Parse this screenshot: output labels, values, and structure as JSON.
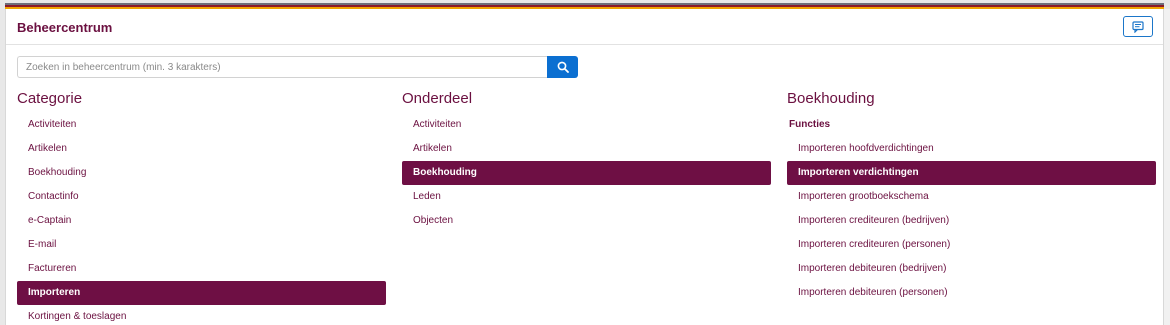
{
  "header": {
    "title": "Beheercentrum",
    "feedback_icon": "comment-icon"
  },
  "search": {
    "placeholder": "Zoeken in beheercentrum (min. 3 karakters)",
    "value": "",
    "button_icon": "search-icon"
  },
  "columns": {
    "categorie": {
      "heading": "Categorie",
      "items": [
        "Activiteiten",
        "Artikelen",
        "Boekhouding",
        "Contactinfo",
        "e-Captain",
        "E-mail",
        "Factureren",
        "Importeren",
        "Kortingen & toeslagen"
      ],
      "active_index": 7
    },
    "onderdeel": {
      "heading": "Onderdeel",
      "items": [
        "Activiteiten",
        "Artikelen",
        "Boekhouding",
        "Leden",
        "Objecten"
      ],
      "active_index": 2
    },
    "boekhouding": {
      "heading": "Boekhouding",
      "section": "Functies",
      "items": [
        "Importeren hoofdverdichtingen",
        "Importeren verdichtingen",
        "Importeren grootboekschema",
        "Importeren crediteuren (bedrijven)",
        "Importeren crediteuren (personen)",
        "Importeren debiteuren (bedrijven)",
        "Importeren debiteuren (personen)"
      ],
      "active_index": 1
    }
  },
  "colors": {
    "brand": "#6e0f44",
    "accent": "#0b6fd1"
  }
}
